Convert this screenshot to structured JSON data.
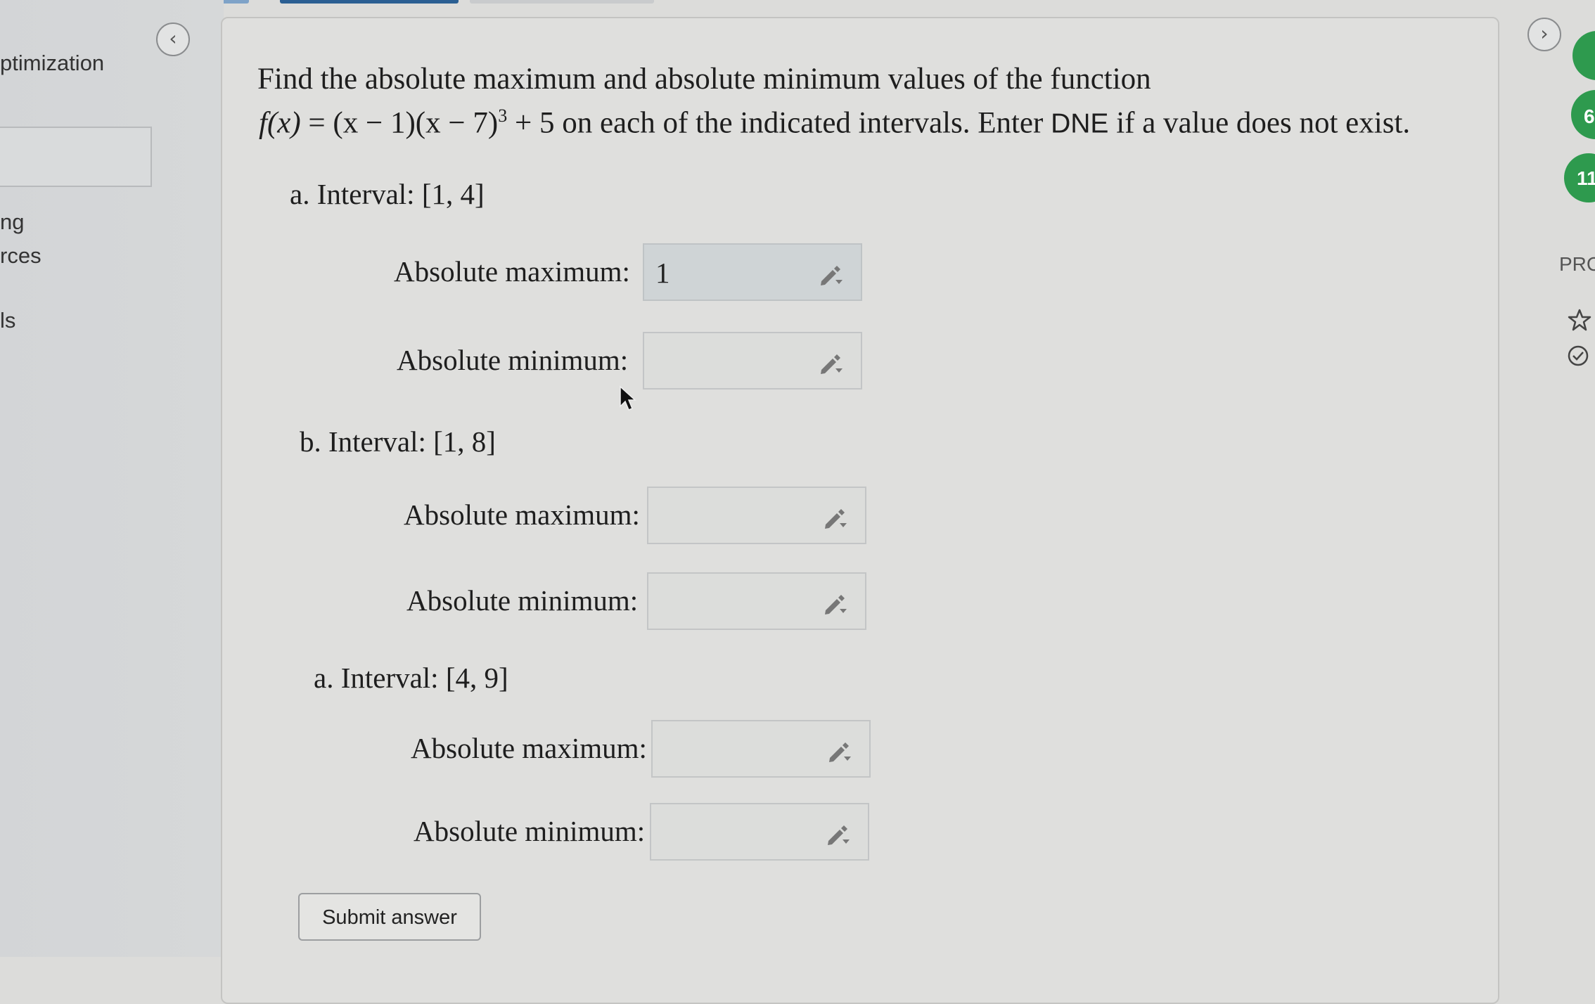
{
  "sidebar": {
    "title": "ptimization",
    "items": [
      "ng",
      "rces",
      "ls"
    ]
  },
  "nav": {
    "back_icon": "‹",
    "forward_icon": "›"
  },
  "question": {
    "line1": "Find the absolute maximum and absolute minimum values of the function",
    "fx": "f(x)",
    "equals": " = (x − 1)(x − 7)",
    "exponent": "3",
    "tail": " + 5 on each of the indicated intervals. Enter ",
    "dne": "DNE",
    "tail2": " if a value does not exist."
  },
  "parts": [
    {
      "head": "a.  Interval: [1, 4]",
      "max_label": "Absolute maximum:",
      "max_value": "1",
      "min_label": "Absolute minimum:",
      "min_value": ""
    },
    {
      "head": "b.  Interval: [1, 8]",
      "max_label": "Absolute maximum:",
      "max_value": "",
      "min_label": "Absolute minimum:",
      "min_value": ""
    },
    {
      "head": "a.  Interval: [4, 9]",
      "max_label": "Absolute maximum:",
      "max_value": "",
      "min_label": "Absolute minimum:",
      "min_value": ""
    }
  ],
  "submit_label": "Submit answer",
  "right_panel": {
    "badge2": "6",
    "badge3": "11",
    "label": "PRC"
  },
  "colors": {
    "badge_green": "#2e9a4e",
    "card_bg": "#dfdfdd"
  }
}
